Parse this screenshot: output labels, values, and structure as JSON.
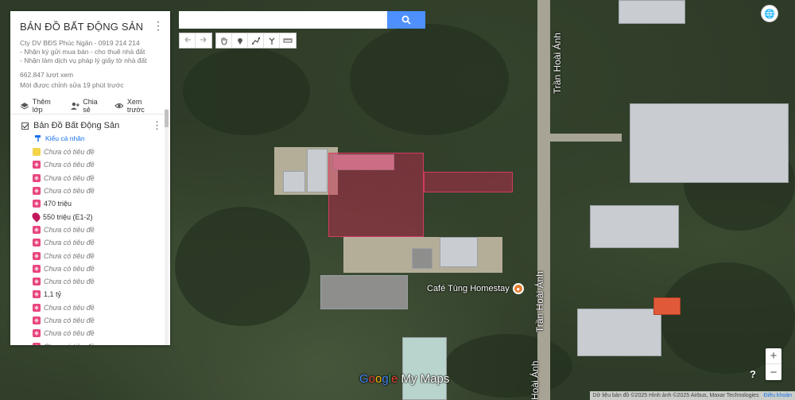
{
  "map": {
    "road_labels": [
      "Trần Hoài Ánh",
      "Trần Hoài Ánh",
      "Hoài Ánh"
    ],
    "poi_label": "Café Tùng Homestay",
    "polygon_color": "#c82850"
  },
  "search": {
    "placeholder": "",
    "value": ""
  },
  "toolbar": {
    "icons": [
      "undo-icon",
      "redo-icon",
      "hand-icon",
      "marker-icon",
      "draw-line-icon",
      "directions-icon",
      "ruler-icon"
    ]
  },
  "panel": {
    "title": "BẢN ĐỒ BẤT ĐỘNG SẢN",
    "desc_lines": [
      "Cty DV BĐS Phúc Ngân - 0919 214 214",
      "- Nhận ký gửi mua bán - cho thuê nhà đất",
      "- Nhận làm dịch vụ pháp lý giấy tờ nhà đất"
    ],
    "views": "662.847 lượt xem",
    "edited": "Mới được chỉnh sửa 19 phút trước",
    "actions": {
      "add_layer": "Thêm lớp",
      "share": "Chia sẻ",
      "preview": "Xem trước"
    },
    "layer": {
      "name": "Bản Đồ Bất Động Sản",
      "style": "Kiểu cá nhân",
      "items": [
        {
          "label": "Chưa có tiêu đề",
          "marker": "yellow"
        },
        {
          "label": "Chưa có tiêu đề",
          "marker": "pink"
        },
        {
          "label": "Chưa có tiêu đề",
          "marker": "pink"
        },
        {
          "label": "Chưa có tiêu đề",
          "marker": "pink"
        },
        {
          "label": "470 triệu",
          "marker": "pink"
        },
        {
          "label": "550 triệu (E1-2)",
          "marker": "pin"
        },
        {
          "label": "Chưa có tiêu đề",
          "marker": "pink"
        },
        {
          "label": "Chưa có tiêu đề",
          "marker": "pink"
        },
        {
          "label": "Chưa có tiêu đề",
          "marker": "pink"
        },
        {
          "label": "Chưa có tiêu đề",
          "marker": "pink"
        },
        {
          "label": "Chưa có tiêu đề",
          "marker": "pink"
        },
        {
          "label": "1,1 tỷ",
          "marker": "pink"
        },
        {
          "label": "Chưa có tiêu đề",
          "marker": "pink"
        },
        {
          "label": "Chưa có tiêu đề",
          "marker": "pink"
        },
        {
          "label": "Chưa có tiêu đề",
          "marker": "pink"
        },
        {
          "label": "Chưa có tiêu đề",
          "marker": "pink"
        },
        {
          "label": "Chưa có tiêu đề",
          "marker": "pink"
        }
      ]
    }
  },
  "logo": {
    "google": "Google",
    "mymaps": " My Maps"
  },
  "attribution": {
    "text": "Dữ liệu bản đồ ©2025 Hình ảnh ©2025 Airbus, Maxar Technologies",
    "terms": "Điều khoản"
  },
  "controls": {
    "zoom_in": "+",
    "zoom_out": "−",
    "help": "?"
  }
}
